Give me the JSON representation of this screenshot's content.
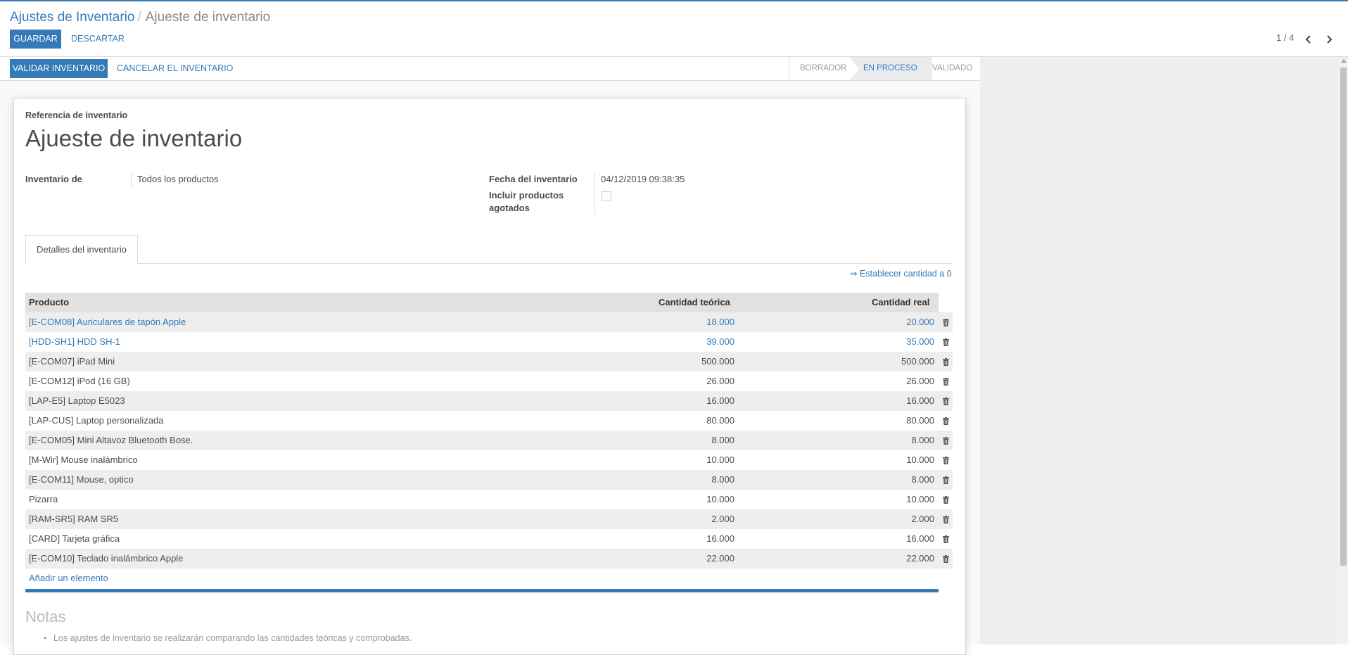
{
  "breadcrumb": {
    "parent": "Ajustes de Inventario",
    "separator": "/",
    "current": "Ajueste de inventario"
  },
  "toolbar": {
    "save_label": "GUARDAR",
    "discard_label": "DESCARTAR"
  },
  "pager": {
    "value": "1 / 4",
    "prev_icon": "chevron-left-icon",
    "next_icon": "chevron-right-icon"
  },
  "actions": {
    "validate_label": "VALIDAR INVENTARIO",
    "cancel_label": "CANCELAR EL INVENTARIO"
  },
  "status": {
    "stages": [
      "BORRADOR",
      "EN PROCESO",
      "VALIDADO"
    ],
    "active": "EN PROCESO"
  },
  "form": {
    "ref_label": "Referencia de inventario",
    "title": "Ajueste de inventario",
    "inventory_of_label": "Inventario de",
    "inventory_of_value": "Todos los productos",
    "date_label": "Fecha del inventario",
    "date_value": "04/12/2019 09:38:35",
    "include_label_1": "Incluir productos",
    "include_label_2": "agotados",
    "include_checked": false
  },
  "tab": {
    "label": "Detalles del inventario"
  },
  "set_zero": "⇒ Establecer cantidad a 0",
  "table": {
    "headers": {
      "product": "Producto",
      "theoretical": "Cantidad teórica",
      "real": "Cantidad real"
    },
    "rows": [
      {
        "product": "[E-COM08] Auriculares de tapón Apple",
        "theoretical": "18.000",
        "real": "20.000",
        "highlight": true
      },
      {
        "product": "[HDD-SH1] HDD SH-1",
        "theoretical": "39.000",
        "real": "35.000",
        "highlight": true
      },
      {
        "product": "[E-COM07] iPad Mini",
        "theoretical": "500.000",
        "real": "500.000",
        "highlight": false
      },
      {
        "product": "[E-COM12] iPod (16 GB)",
        "theoretical": "26.000",
        "real": "26.000",
        "highlight": false
      },
      {
        "product": "[LAP-E5] Laptop E5023",
        "theoretical": "16.000",
        "real": "16.000",
        "highlight": false
      },
      {
        "product": "[LAP-CUS] Laptop personalizada",
        "theoretical": "80.000",
        "real": "80.000",
        "highlight": false
      },
      {
        "product": "[E-COM05] Mini Altavoz Bluetooth Bose.",
        "theoretical": "8.000",
        "real": "8.000",
        "highlight": false
      },
      {
        "product": "[M-Wir] Mouse inalámbrico",
        "theoretical": "10.000",
        "real": "10.000",
        "highlight": false
      },
      {
        "product": "[E-COM11] Mouse, optico",
        "theoretical": "8.000",
        "real": "8.000",
        "highlight": false
      },
      {
        "product": "Pizarra",
        "theoretical": "10.000",
        "real": "10.000",
        "highlight": false
      },
      {
        "product": "[RAM-SR5] RAM SR5",
        "theoretical": "2.000",
        "real": "2.000",
        "highlight": false
      },
      {
        "product": "[CARD] Tarjeta gráfica",
        "theoretical": "16.000",
        "real": "16.000",
        "highlight": false
      },
      {
        "product": "[E-COM10] Teclado inalámbrico Apple",
        "theoretical": "22.000",
        "real": "22.000",
        "highlight": false
      }
    ],
    "add_line": "Añadir un elemento"
  },
  "notes": {
    "title": "Notas",
    "items": [
      "Los ajustes de inventario se realizarán comparando las cantidades teóricas y comprobadas."
    ]
  },
  "colors": {
    "accent": "#337ab7",
    "text": "#4c4c4c",
    "row_alt": "#eeeeee",
    "header_bg": "#e1e1e1"
  }
}
